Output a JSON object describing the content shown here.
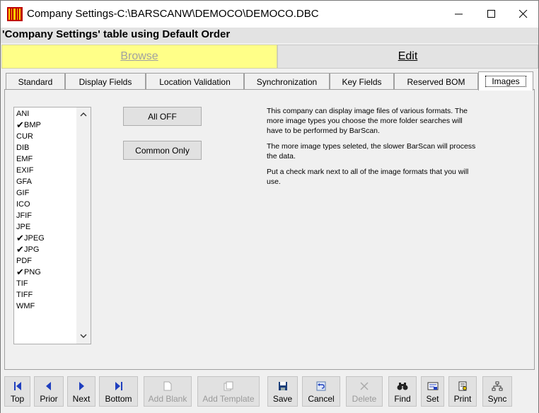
{
  "window": {
    "title": "Company Settings-C:\\BARSCANW\\DEMOCO\\DEMOCO.DBC"
  },
  "caption": "'Company Settings' table using Default Order",
  "modes": {
    "browse": "Browse",
    "edit": "Edit"
  },
  "tabs": [
    {
      "label": "Standard"
    },
    {
      "label": "Display Fields"
    },
    {
      "label": "Location Validation"
    },
    {
      "label": "Synchronization"
    },
    {
      "label": "Key Fields"
    },
    {
      "label": "Reserved BOM"
    },
    {
      "label": "Images",
      "active": true
    }
  ],
  "formats": [
    {
      "label": "ANI",
      "checked": false
    },
    {
      "label": "BMP",
      "checked": true
    },
    {
      "label": "CUR",
      "checked": false
    },
    {
      "label": "DIB",
      "checked": false
    },
    {
      "label": "EMF",
      "checked": false
    },
    {
      "label": "EXIF",
      "checked": false
    },
    {
      "label": "GFA",
      "checked": false
    },
    {
      "label": "GIF",
      "checked": false
    },
    {
      "label": "ICO",
      "checked": false
    },
    {
      "label": "JFIF",
      "checked": false
    },
    {
      "label": "JPE",
      "checked": false
    },
    {
      "label": "JPEG",
      "checked": true
    },
    {
      "label": "JPG",
      "checked": true
    },
    {
      "label": "PDF",
      "checked": false
    },
    {
      "label": "PNG",
      "checked": true
    },
    {
      "label": "TIF",
      "checked": false
    },
    {
      "label": "TIFF",
      "checked": false
    },
    {
      "label": "WMF",
      "checked": false
    }
  ],
  "buttons": {
    "all_off": "All OFF",
    "common_only": "Common Only"
  },
  "description": [
    "This company can display image files of various formats. The more image types you choose the more folder searches will have to be performed by BarScan.",
    "The more image types seleted, the slower BarScan will process the data.",
    "Put a check mark next to all of the image formats that you will use."
  ],
  "toolbar": [
    {
      "label": "Top",
      "icon": "first-icon",
      "enabled": true
    },
    {
      "label": "Prior",
      "icon": "prior-icon",
      "enabled": true
    },
    {
      "label": "Next",
      "icon": "next-icon",
      "enabled": true
    },
    {
      "label": "Bottom",
      "icon": "last-icon",
      "enabled": true
    },
    {
      "label": "Add Blank",
      "icon": "blank-page-icon",
      "enabled": false
    },
    {
      "label": "Add Template",
      "icon": "template-icon",
      "enabled": false
    },
    {
      "label": "Save",
      "icon": "floppy-disk-icon",
      "enabled": true
    },
    {
      "label": "Cancel",
      "icon": "undo-icon",
      "enabled": true
    },
    {
      "label": "Delete",
      "icon": "delete-x-icon",
      "enabled": false
    },
    {
      "label": "Find",
      "icon": "binoculars-icon",
      "enabled": true
    },
    {
      "label": "Set",
      "icon": "set-icon",
      "enabled": true
    },
    {
      "label": "Print",
      "icon": "print-icon",
      "enabled": true
    },
    {
      "label": "Sync",
      "icon": "network-icon",
      "enabled": true
    }
  ],
  "colors": {
    "browse_bg": "#ffff88",
    "nav_blue": "#1f3fbf",
    "disabled_text": "#9a9a9a"
  }
}
